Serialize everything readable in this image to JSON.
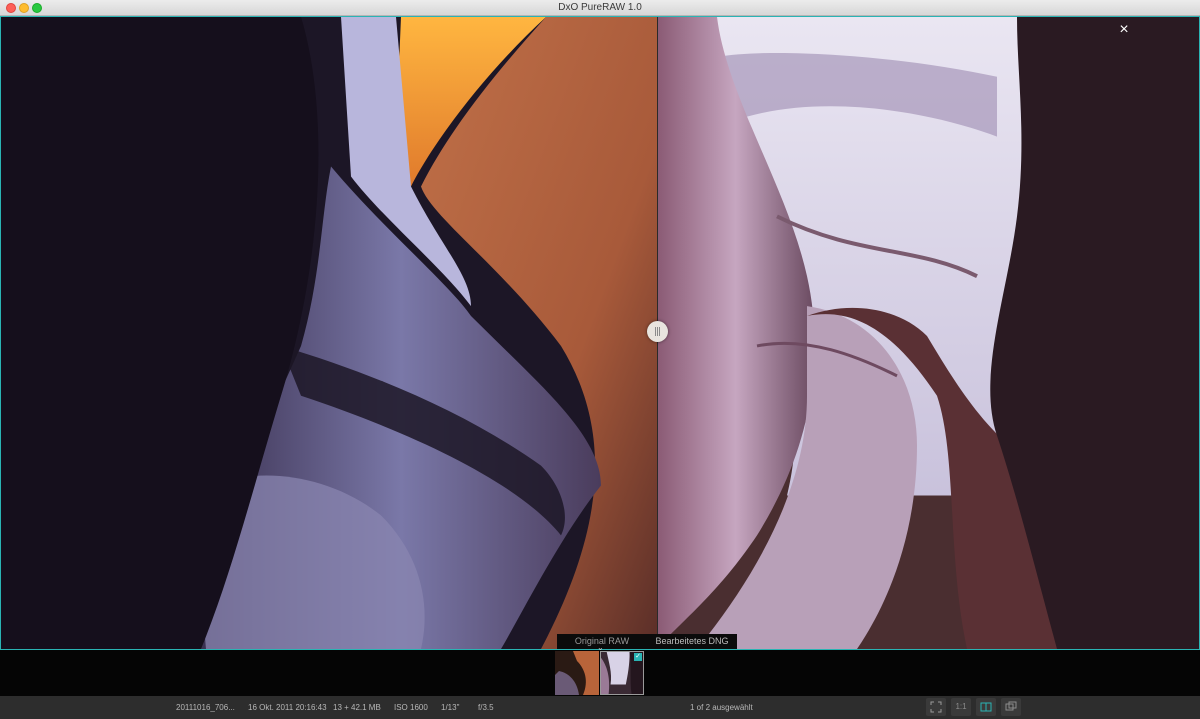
{
  "window": {
    "title": "DxO PureRAW 1.0"
  },
  "viewer": {
    "close_icon": "×",
    "compare": {
      "left_label": "Original RAW",
      "right_label": "Bearbeitetes DNG"
    }
  },
  "filmstrip": {
    "thumbnails": [
      {
        "selected": false
      },
      {
        "selected": true,
        "check": "✓"
      }
    ]
  },
  "status": {
    "filename": "20111016_706...",
    "datetime": "16 Okt. 2011 20:16:43",
    "size": "13 + 42.1 MB",
    "iso": "ISO 1600",
    "shutter": "1/13\"",
    "aperture": "f/3.5",
    "selection": "1 of 2 ausgewählt",
    "tools": [
      "fit-icon",
      "one-to-one-icon",
      "split-compare-icon",
      "side-by-side-icon"
    ],
    "one_to_one_label": "1:1"
  },
  "colors": {
    "accent": "#2ab4b4",
    "chrome": "#2d2d2d"
  }
}
